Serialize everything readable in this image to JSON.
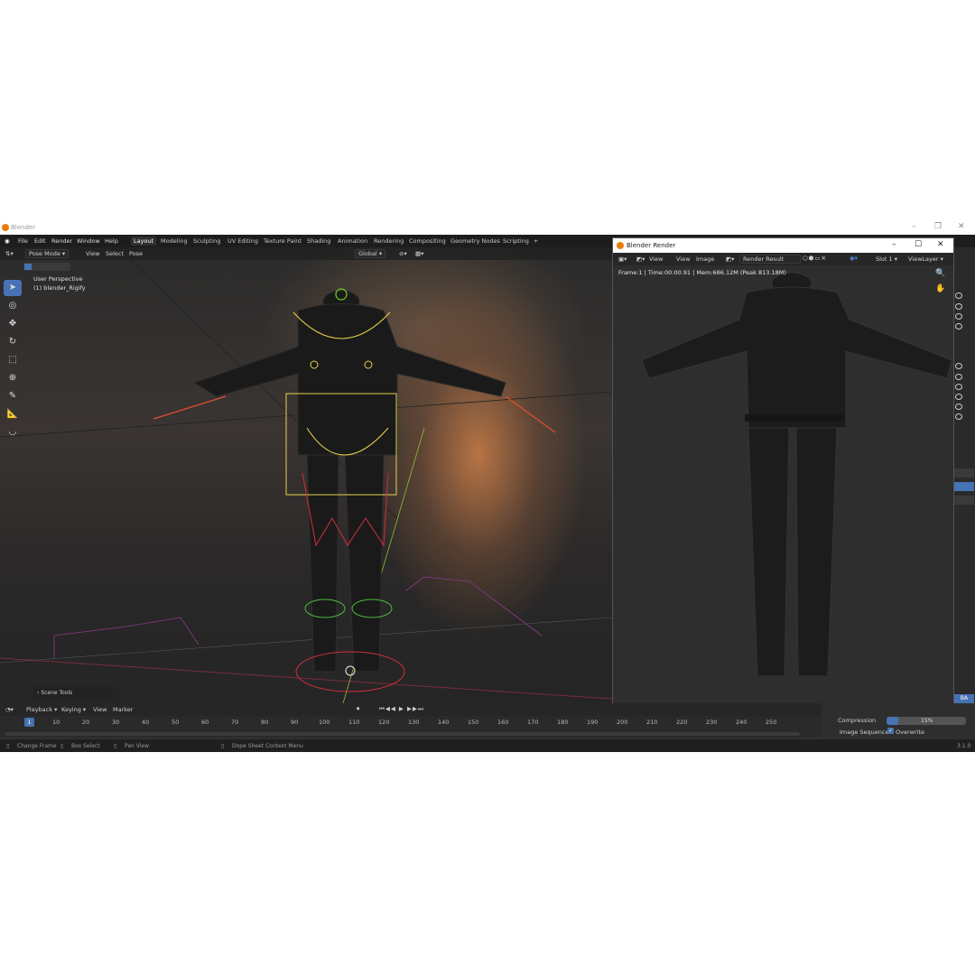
{
  "app": {
    "title": "Blender",
    "version": "3.1.0"
  },
  "menu": [
    "File",
    "Edit",
    "Render",
    "Window",
    "Help"
  ],
  "workspaces": [
    "Layout",
    "Modeling",
    "Sculpting",
    "UV Editing",
    "Texture Paint",
    "Shading",
    "Animation",
    "Rendering",
    "Compositing",
    "Geometry Nodes",
    "Scripting"
  ],
  "active_workspace": "Layout",
  "viewport": {
    "mode": "Pose Mode",
    "menus": [
      "View",
      "Select",
      "Pose"
    ],
    "transform_orientation": "Global",
    "overlay_line1": "User Perspective",
    "overlay_line2": "(1) blender_Rigify",
    "scene_tools": "Scene Tools"
  },
  "render_window": {
    "title": "Blender Render",
    "menus": [
      "View",
      "View",
      "Image"
    ],
    "image_name": "Render Result",
    "slot": "Slot 1",
    "view_layer": "ViewLayer",
    "info": "Frame:1 | Time:00:00.91 | Mem:686.12M (Peak 813.18M)"
  },
  "timeline": {
    "menus": [
      "Playback",
      "Keying",
      "View",
      "Marker"
    ],
    "current_frame": "1",
    "ticks": [
      "10",
      "20",
      "30",
      "40",
      "50",
      "60",
      "70",
      "80",
      "90",
      "100",
      "110",
      "120",
      "130",
      "140",
      "150",
      "160",
      "170",
      "180",
      "190",
      "200",
      "210",
      "220",
      "230",
      "240",
      "250"
    ]
  },
  "properties": {
    "compression_label": "Compression",
    "compression_value": "15%",
    "compression_fraction": 0.15,
    "image_sequence_label": "Image Sequence",
    "overwrite_label": "Overwrite",
    "ba_label": "BA"
  },
  "statusbar": {
    "change_frame": "Change Frame",
    "box_select": "Box Select",
    "pan_view": "Pan View",
    "context_menu": "Dope Sheet Context Menu"
  },
  "colors": {
    "accent": "#4772b3",
    "blender_orange": "#e87d0d"
  }
}
